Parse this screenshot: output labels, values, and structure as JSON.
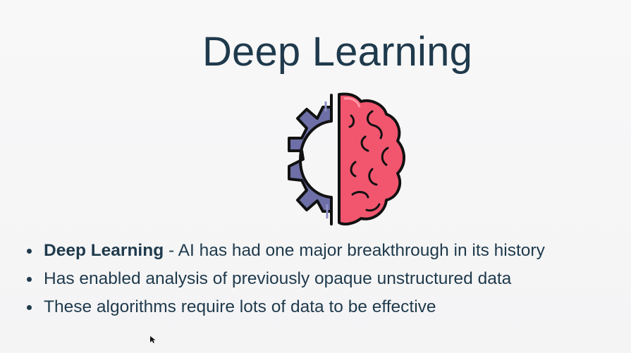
{
  "slide": {
    "title": "Deep Learning",
    "logo_icon": "gear-brain-icon",
    "colors": {
      "text": "#1f3a4c",
      "gear": "#6d6fa6",
      "brain": "#f2566f"
    },
    "bullets": [
      {
        "bold": "Deep Learning",
        "text": " - AI has had one major breakthrough in its history"
      },
      {
        "bold": "",
        "text": "Has enabled analysis of previously opaque unstructured data"
      },
      {
        "bold": "",
        "text": "These algorithms require lots of data to be effective"
      }
    ]
  },
  "cursor_icon": "mouse-pointer-icon"
}
